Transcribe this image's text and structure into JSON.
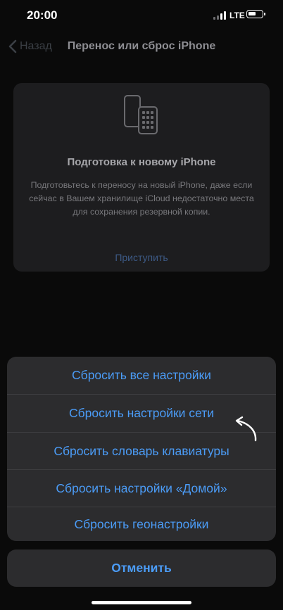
{
  "status_bar": {
    "time": "20:00",
    "network": "LTE",
    "battery_level": 0.6
  },
  "nav": {
    "back_label": "Назад",
    "title": "Перенос или сброс iPhone"
  },
  "card": {
    "heading": "Подготовка к новому iPhone",
    "body": "Подготовьтесь к переносу на новый iPhone, даже если сейчас в Вашем хранилище iCloud недостаточно места для сохранения резервной копии.",
    "action": "Приступить"
  },
  "action_sheet": {
    "items": [
      {
        "label": "Сбросить все настройки"
      },
      {
        "label": "Сбросить настройки сети"
      },
      {
        "label": "Сбросить словарь клавиатуры"
      },
      {
        "label": "Сбросить настройки «Домой»"
      },
      {
        "label": "Сбросить геонастройки"
      }
    ],
    "cancel": "Отменить"
  },
  "colors": {
    "accent": "#4b9cf7",
    "sheet_bg": "#2c2c2e",
    "background": "#0a0a0a"
  }
}
